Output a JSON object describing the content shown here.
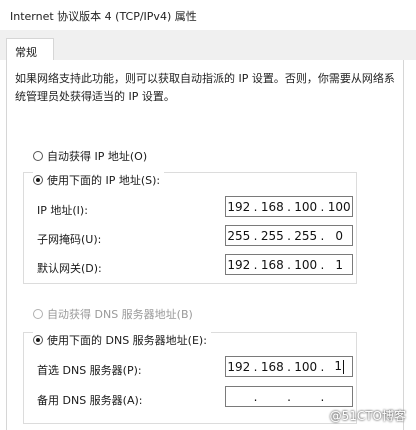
{
  "window": {
    "title": "Internet 协议版本 4 (TCP/IPv4) 属性"
  },
  "tabs": [
    {
      "label": "常规"
    }
  ],
  "description": "如果网络支持此功能，则可以获取自动指派的 IP 设置。否则，你需要从网络系统管理员处获得适当的 IP 设置。",
  "ip_section": {
    "auto_label": "自动获得 IP 地址(O)",
    "manual_label": "使用下面的 IP 地址(S):",
    "selected": "manual",
    "fields": [
      {
        "label": "IP 地址(I):",
        "octets": [
          "192",
          "168",
          "100",
          "100"
        ]
      },
      {
        "label": "子网掩码(U):",
        "octets": [
          "255",
          "255",
          "255",
          "0"
        ]
      },
      {
        "label": "默认网关(D):",
        "octets": [
          "192",
          "168",
          "100",
          "1"
        ]
      }
    ]
  },
  "dns_section": {
    "auto_label": "自动获得 DNS 服务器地址(B)",
    "manual_label": "使用下面的 DNS 服务器地址(E):",
    "selected": "manual",
    "fields": [
      {
        "label": "首选 DNS 服务器(P):",
        "octets": [
          "192",
          "168",
          "100",
          "1"
        ]
      },
      {
        "label": "备用 DNS 服务器(A):",
        "octets": [
          "",
          "",
          "",
          ""
        ]
      }
    ]
  },
  "watermark": "@51CTO博客"
}
